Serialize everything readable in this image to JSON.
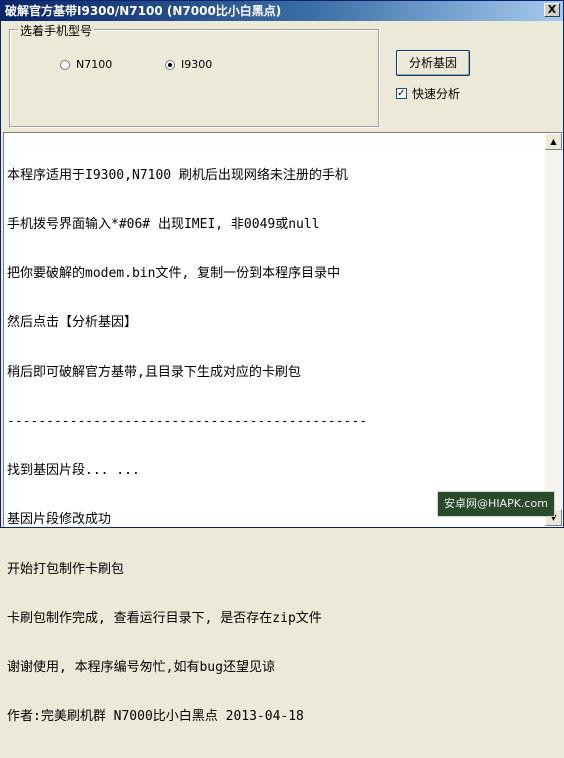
{
  "window": {
    "title": "破解官方基带I9300/N7100 (N7000比小白黑点)",
    "close_label": "X"
  },
  "phone_group": {
    "legend": "选着手机型号",
    "options": [
      {
        "label": "N7100",
        "selected": false
      },
      {
        "label": "I9300",
        "selected": true
      }
    ]
  },
  "actions": {
    "analyze_button": "分析基因",
    "fast_checkbox_label": "快速分析",
    "fast_checkbox_checked": true,
    "check_mark": "✓"
  },
  "output": {
    "lines": [
      "本程序适用于I9300,N7100 刷机后出现网络未注册的手机",
      "手机拨号界面输入*#06# 出现IMEI, 非0049或null",
      "把你要破解的modem.bin文件, 复制一份到本程序目录中",
      "然后点击【分析基因】",
      "稍后即可破解官方基带,且目录下生成对应的卡刷包",
      "----------------------------------------------",
      "找到基因片段... ...",
      "基因片段修改成功",
      "开始打包制作卡刷包",
      "卡刷包制作完成, 查看运行目录下, 是否存在zip文件",
      "谢谢使用, 本程序编号匆忙,如有bug还望见谅",
      "作者:完美刷机群 N7000比小白黑点 2013-04-18"
    ]
  },
  "scrollbar": {
    "up_arrow": "▲",
    "down_arrow": "▼"
  },
  "watermark": {
    "text": "安卓网@HIAPK.com"
  }
}
